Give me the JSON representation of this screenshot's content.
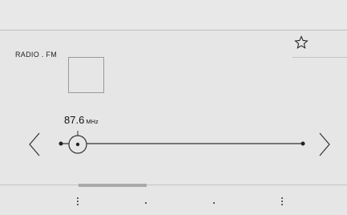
{
  "source": {
    "label": "RADIO . FM"
  },
  "station": {
    "frequency": "87.6",
    "unit": "MHz"
  },
  "icons": {
    "favorite": "star-outline-icon",
    "previous": "chevron-left-icon",
    "next": "chevron-right-icon",
    "menu": "vertical-dots-icon"
  },
  "colors": {
    "background": "#e6e6e6",
    "line": "#333333"
  }
}
